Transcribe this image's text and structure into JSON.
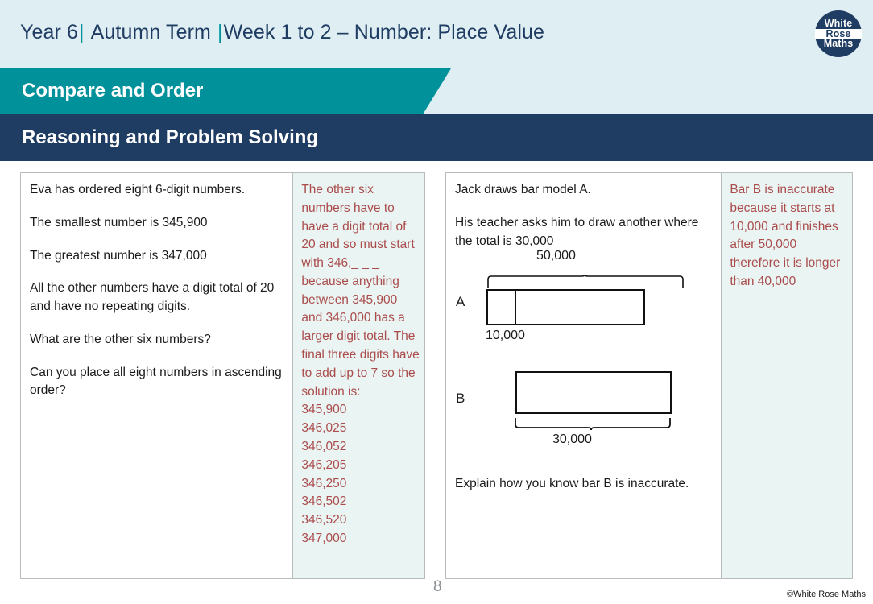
{
  "header": {
    "year": "Year 6",
    "term": "Autumn Term",
    "week": "Week 1 to 2 – Number: Place Value",
    "separator": "|",
    "logo": {
      "line1": "White",
      "line2": "Rose",
      "line3": "Maths"
    }
  },
  "banners": {
    "topic": "Compare and Order",
    "section": "Reasoning and Problem Solving",
    "teal_color": "#00919b",
    "navy_color": "#1f3c63",
    "page_background": "#dfeef2"
  },
  "questions": [
    {
      "question_text": "Eva has ordered eight 6-digit numbers.\n\nThe smallest number is 345,900\n\nThe greatest number is 347,000\n\nAll the other numbers have a digit total of 20 and have no repeating digits.\n\nWhat are the other six numbers?\n\nCan you place all eight numbers in ascending order?",
      "question_paragraphs": [
        "Eva has ordered eight 6-digit numbers.",
        "The smallest number is 345,900",
        "The greatest number is 347,000",
        "All the other numbers have a digit total of 20 and have no repeating digits.",
        "What are the other six numbers?",
        "Can you place all eight numbers in ascending order?"
      ],
      "answer_text": "The other six numbers have to have a digit total of 20 and so must start with 346,_ _ _ because anything between 345,900 and 346,000 has a larger digit total. The final three digits have to add up to 7 so the solution is:\n345,900\n346,025\n346,052\n346,205\n346,250\n346,502\n346,520\n347,000",
      "answer_color": "#ab4c4c",
      "answer_background": "#e9f4f3"
    },
    {
      "question_paragraphs": [
        "Jack draws bar model A.",
        "His teacher asks him to draw another where the total is 30,000"
      ],
      "question_intro": "Jack draws bar model A.\nHis teacher asks him to draw another where the total is 30,000",
      "bar_models": [
        {
          "name": "A",
          "top_label": "50,000",
          "bottom_label": "10,000",
          "brace_position": "top"
        },
        {
          "name": "B",
          "bottom_label": "30,000",
          "brace_position": "bottom"
        }
      ],
      "explain_prompt": "Explain how you know bar B is inaccurate.",
      "answer_text": "Bar B is inaccurate because it starts at 10,000 and finishes after 50,000 therefore it is longer than 40,000",
      "answer_color": "#ab4c4c",
      "answer_background": "#e9f4f3"
    }
  ],
  "footer": {
    "page_number": "8",
    "copyright": "©White Rose Maths"
  }
}
